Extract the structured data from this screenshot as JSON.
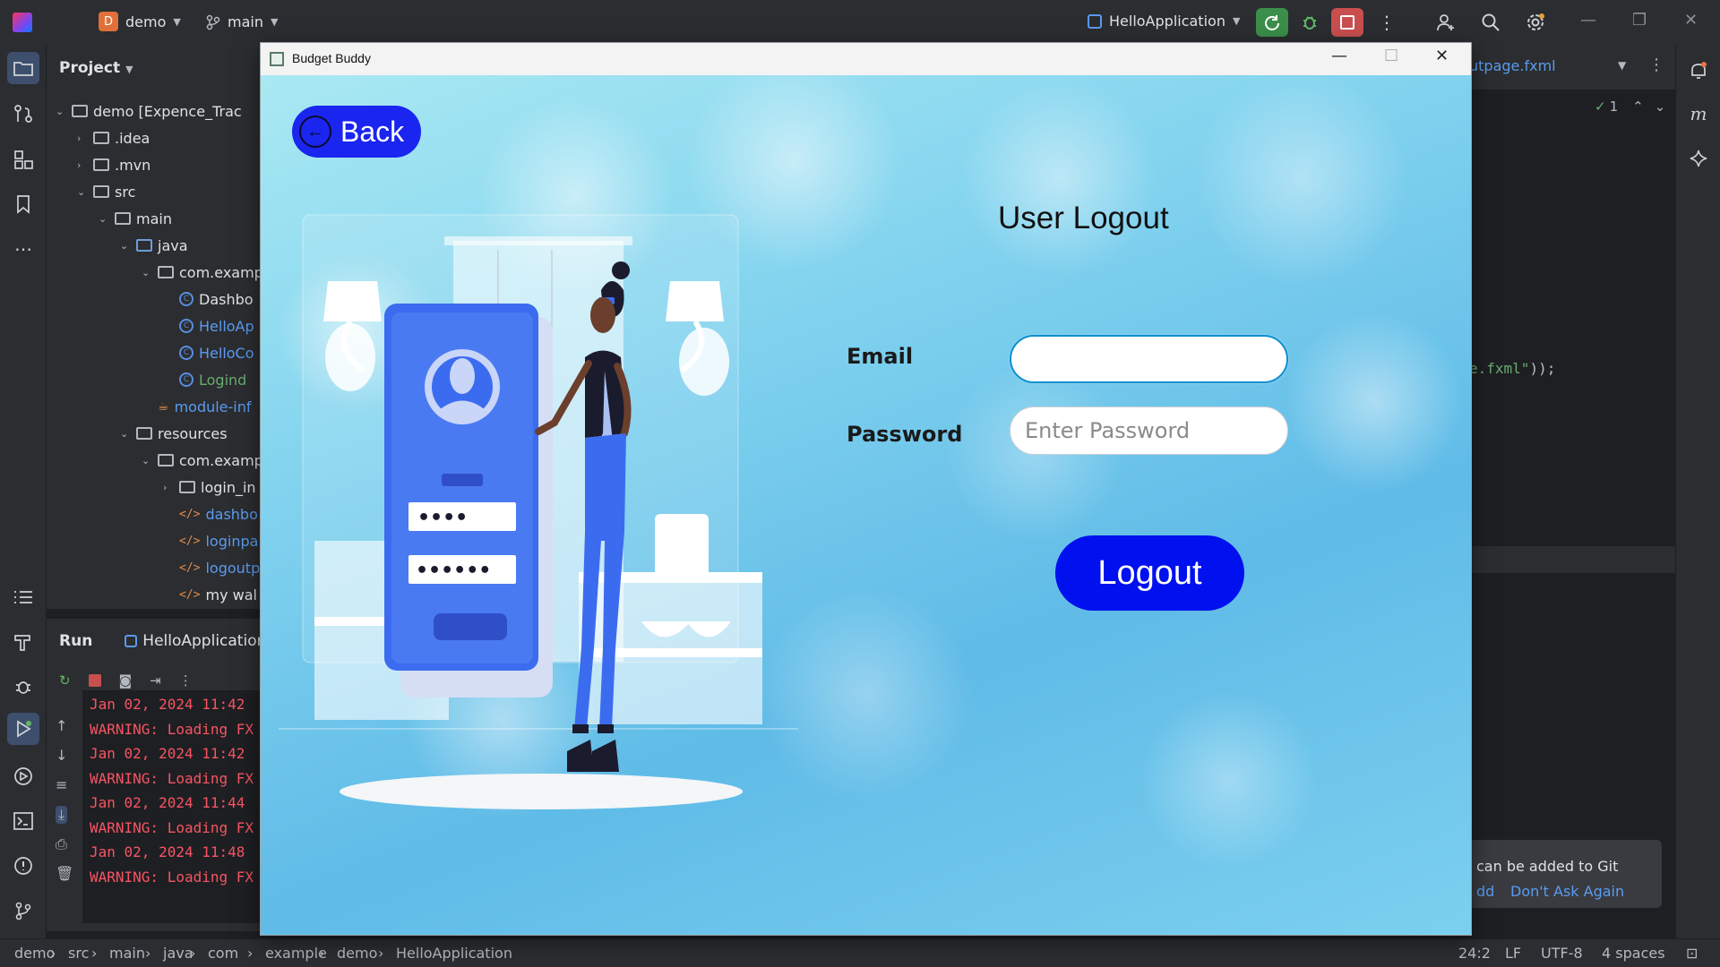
{
  "ide": {
    "project_name": "demo",
    "project_badge": "D",
    "branch": "main",
    "run_config": "HelloApplication",
    "project_panel_title": "Project",
    "tree": [
      {
        "label": "demo [Expence_Trac",
        "type": "module",
        "depth": 0,
        "expanded": true
      },
      {
        "label": ".idea",
        "type": "folder",
        "depth": 1,
        "expanded": false
      },
      {
        "label": ".mvn",
        "type": "folder",
        "depth": 1,
        "expanded": false
      },
      {
        "label": "src",
        "type": "folder",
        "depth": 1,
        "expanded": true
      },
      {
        "label": "main",
        "type": "folder",
        "depth": 2,
        "expanded": true
      },
      {
        "label": "java",
        "type": "folder-blue",
        "depth": 3,
        "expanded": true
      },
      {
        "label": "com.examp",
        "type": "package",
        "depth": 4,
        "expanded": true
      },
      {
        "label": "Dashbo",
        "type": "class",
        "depth": 5,
        "color": "default"
      },
      {
        "label": "HelloAp",
        "type": "class",
        "depth": 5,
        "color": "blue"
      },
      {
        "label": "HelloCo",
        "type": "class",
        "depth": 5,
        "color": "blue"
      },
      {
        "label": "Logind",
        "type": "class",
        "depth": 5,
        "color": "green"
      },
      {
        "label": "module-inf",
        "type": "module-info",
        "depth": 4,
        "color": "blue"
      },
      {
        "label": "resources",
        "type": "folder",
        "depth": 3,
        "expanded": true
      },
      {
        "label": "com.examp",
        "type": "package",
        "depth": 4,
        "expanded": true
      },
      {
        "label": "login_in",
        "type": "folder",
        "depth": 5,
        "expanded": false
      },
      {
        "label": "dashbo",
        "type": "xml",
        "depth": 5,
        "color": "blue"
      },
      {
        "label": "loginpa",
        "type": "xml",
        "depth": 5,
        "color": "blue"
      },
      {
        "label": "logoutp",
        "type": "xml",
        "depth": 5,
        "color": "blue"
      },
      {
        "label": "my wal",
        "type": "xml",
        "depth": 5,
        "color": "default"
      }
    ],
    "run_panel": {
      "tab_run": "Run",
      "tab_config": "HelloApplication",
      "console_lines": [
        "Jan 02, 2024 11:42",
        "WARNING: Loading FX",
        "Jan 02, 2024 11:42",
        "WARNING: Loading FX",
        "Jan 02, 2024 11:44",
        "WARNING: Loading FX",
        "Jan 02, 2024 11:48",
        "WARNING: Loading FX"
      ]
    },
    "editor": {
      "tab_fragment": "utpage.fxml",
      "inspection_count": "1",
      "code_fragment_file": "e.fxml\"",
      "code_fragment_rest": "));"
    },
    "notification": {
      "text": "can be added to Git",
      "link_add": "dd",
      "link_dont_ask": "Don't Ask Again"
    },
    "breadcrumbs": [
      "demo",
      "src",
      "main",
      "java",
      "com",
      "example",
      "demo",
      "HelloApplication"
    ],
    "status": {
      "position": "24:2",
      "line_sep": "LF",
      "encoding": "UTF-8",
      "indent": "4 spaces"
    }
  },
  "app_window": {
    "title": "Budget Buddy",
    "back_label": "Back",
    "heading": "User Logout",
    "email_label": "Email",
    "email_value": "",
    "password_label": "Password",
    "password_placeholder": "Enter Password",
    "logout_label": "Logout",
    "illustration_pw_field_1": "••••",
    "illustration_pw_field_2": "••••••"
  },
  "colors": {
    "ide_bg": "#1e1f22",
    "ide_panel": "#2b2d30",
    "back_button": "#1a25ef",
    "logout_button": "#0010ee",
    "console_warning": "#f75464"
  }
}
